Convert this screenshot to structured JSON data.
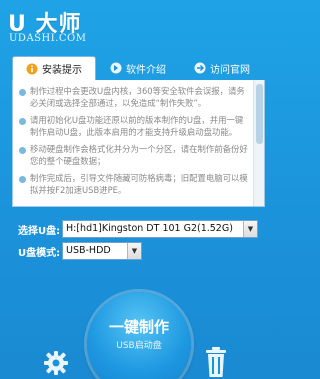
{
  "header": {
    "logo_text": "U 大师",
    "domain": "UDASHI.COM"
  },
  "tabs": [
    {
      "label": "安装提示"
    },
    {
      "label": "软件介绍"
    },
    {
      "label": "访问官网"
    }
  ],
  "tips": [
    "制作过程中会更改U盘内核，360等安全软件会误报，请务必关闭或选择全部通过，以免造成“制作失败”。",
    "请用初始化U盘功能还原以前的版本制作的U盘，并用一键制作启动U盘，此版本启用的才能支持升级启动盘功能。",
    "移动硬盘制作会格式化并分为一个分区，请在制作前备份好您的整个硬盘数据；",
    "制作完成后，引导文件随藏可防格病毒；旧配置电脑可以模拟并按F2加速USB进PE。"
  ],
  "form": {
    "disk_label": "选择U盘:",
    "disk_value": "H:[hd1]Kingston DT 101 G2(1.52G)",
    "mode_label": "U盘模式:",
    "mode_value": "USB-HDD"
  },
  "main_button": {
    "line1": "一键制作",
    "line2": "USB启动盘"
  },
  "colors": {
    "background": "#1b93db",
    "accent": "#1e98e1"
  }
}
